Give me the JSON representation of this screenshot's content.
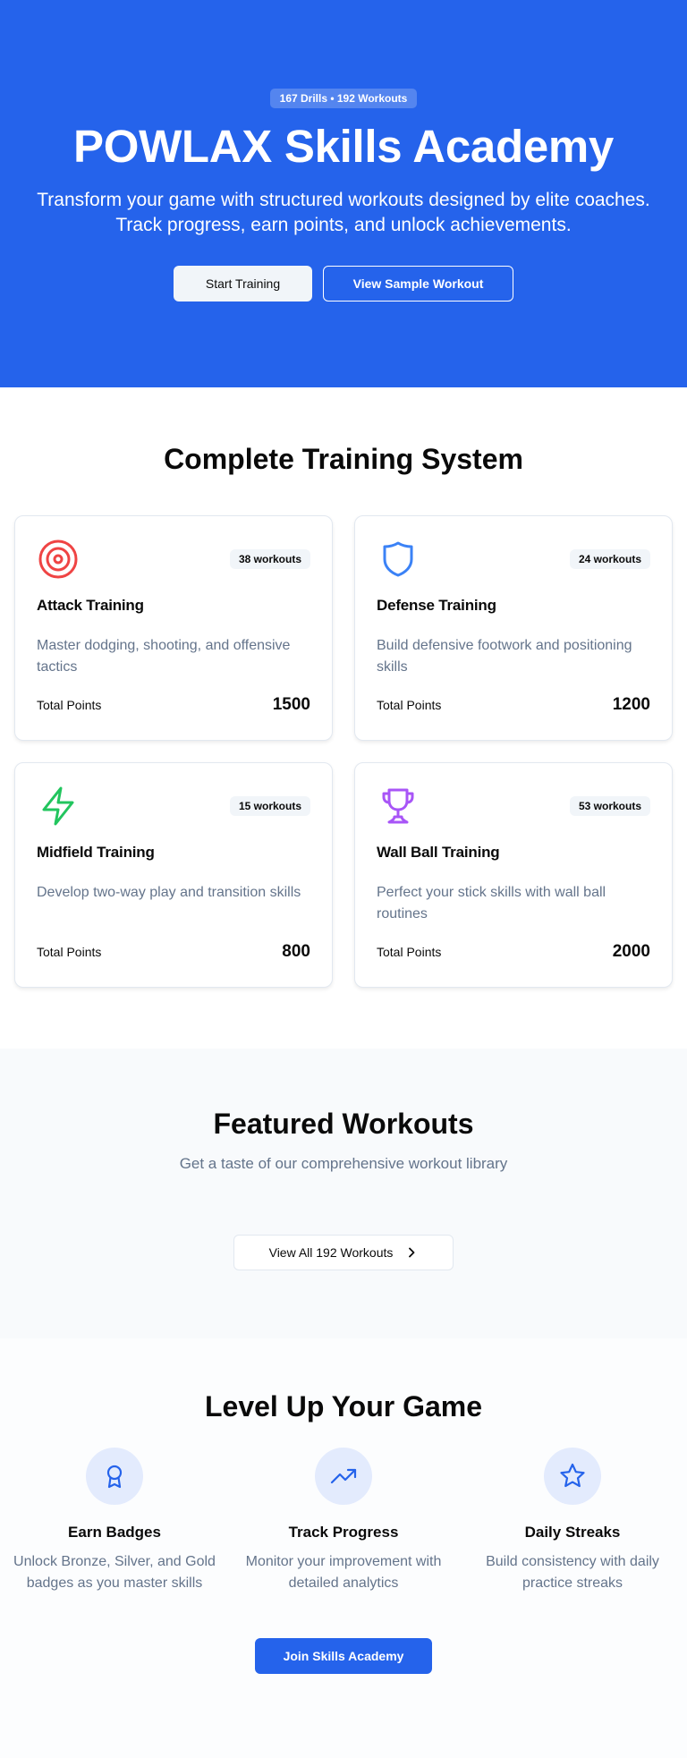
{
  "hero": {
    "badge": "167 Drills • 192 Workouts",
    "title": "POWLAX Skills Academy",
    "subtitle": "Transform your game with structured workouts designed by elite coaches. Track progress, earn points, and unlock achievements.",
    "primary_button": "Start Training",
    "secondary_button": "View Sample Workout",
    "background_color": "#2563eb"
  },
  "training_system": {
    "title": "Complete Training System",
    "points_label": "Total Points",
    "cards": [
      {
        "icon": "target-icon",
        "color": "#ef4444",
        "badge": "38 workouts",
        "title": "Attack Training",
        "description": "Master dodging, shooting, and offensive tactics",
        "points": "1500"
      },
      {
        "icon": "shield-icon",
        "color": "#3b82f6",
        "badge": "24 workouts",
        "title": "Defense Training",
        "description": "Build defensive footwork and positioning skills",
        "points": "1200"
      },
      {
        "icon": "zap-icon",
        "color": "#22c55e",
        "badge": "15 workouts",
        "title": "Midfield Training",
        "description": "Develop two-way play and transition skills",
        "points": "800"
      },
      {
        "icon": "trophy-icon",
        "color": "#a855f7",
        "badge": "53 workouts",
        "title": "Wall Ball Training",
        "description": "Perfect your stick skills with wall ball routines",
        "points": "2000"
      }
    ]
  },
  "featured": {
    "title": "Featured Workouts",
    "subtitle": "Get a taste of our comprehensive workout library",
    "button": "View All 192 Workouts"
  },
  "level_up": {
    "title": "Level Up Your Game",
    "features": [
      {
        "icon": "award-icon",
        "title": "Earn Badges",
        "description": "Unlock Bronze, Silver, and Gold badges as you master skills"
      },
      {
        "icon": "trending-up-icon",
        "title": "Track Progress",
        "description": "Monitor your improvement with detailed analytics"
      },
      {
        "icon": "star-icon",
        "title": "Daily Streaks",
        "description": "Build consistency with daily practice streaks"
      }
    ],
    "button": "Join Skills Academy"
  }
}
